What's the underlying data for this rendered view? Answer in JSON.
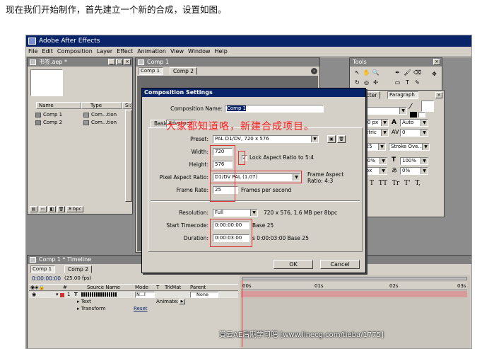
{
  "caption": "现在我们开始制作，首先建立一个新的合成，设置如图。",
  "app": {
    "title": "Adobe After Effects",
    "menu": [
      "File",
      "Edit",
      "Composition",
      "Layer",
      "Effect",
      "Animation",
      "View",
      "Window",
      "Help"
    ]
  },
  "project": {
    "title": "书签.aep *",
    "columns": {
      "name": "Name",
      "type": "Type",
      "size": "Si:"
    },
    "items": [
      {
        "name": "Comp 1",
        "type": "Com...tion"
      },
      {
        "name": "Comp 2",
        "type": "Com...tion"
      }
    ],
    "footer_bpc": "8 bpc"
  },
  "comp_window": {
    "title": "Comp 1",
    "tabs": [
      "Comp 1",
      "Comp 2"
    ]
  },
  "tools": {
    "title": "Tools"
  },
  "character": {
    "tabs": [
      "racter",
      "Paragraph"
    ],
    "font": "ar",
    "size": "100 px",
    "leading": "Auto",
    "kerning": "Metric",
    "tracking": "0",
    "stroke_width": "0.25",
    "stroke_mode": "Stroke Ove...",
    "vscale": "100%",
    "hscale": "100%",
    "baseline": "0 px",
    "tsume": "0%",
    "styles": [
      "T",
      "T",
      "TT",
      "Tr",
      "T'",
      "T,"
    ]
  },
  "dialog": {
    "title": "Composition Settings",
    "comp_name_label": "Composition Name:",
    "comp_name": "Comp 1",
    "tabs": [
      "Basic",
      "Advanced"
    ],
    "preset_label": "Preset:",
    "preset": "PAL D1/DV, 720 x 576",
    "width_label": "Width:",
    "width": "720",
    "height_label": "Height:",
    "height": "576",
    "lock_label": "Lock Aspect Ratio to 5:4",
    "par_label": "Pixel Aspect Ratio:",
    "par": "D1/DV PAL (1.07)",
    "frame_aspect": "Frame Aspect\nRatio: 4:3",
    "framerate_label": "Frame Rate:",
    "framerate": "25",
    "framerate_unit": "Frames per second",
    "resolution_label": "Resolution:",
    "resolution": "Full",
    "resolution_info": "720 x 576, 1.6 MB per 8bpc",
    "start_tc_label": "Start Timecode:",
    "start_tc": "0:00:00:00",
    "start_tc_base": "Base 25",
    "duration_label": "Duration:",
    "duration": "0:00:03:00",
    "duration_info": "s 0:00:03:00  Base 25",
    "ok": "OK",
    "cancel": "Cancel"
  },
  "annotation": "大家都知道咯，新建合成项目。",
  "timeline": {
    "title": "Comp 1 * Timeline",
    "tabs": [
      "Comp 1",
      "Comp 2"
    ],
    "timecode": "0:00:00:00",
    "fps": "(25.00 fps)",
    "columns": [
      "#",
      "Source Name",
      "Mode",
      "T",
      "TrkMat",
      "Parent"
    ],
    "layer": {
      "num": "1",
      "name": "T",
      "mode": "N...l",
      "parent": "None"
    },
    "sub": [
      {
        "name": "Text",
        "extra": "Animate:"
      },
      {
        "name": "Transform",
        "extra": "Reset"
      }
    ],
    "ruler": [
      "00s",
      "01s",
      "02s",
      "03s"
    ]
  },
  "watermark": "賞云AE后期学习吧 [www.linecg.com/tieba/1775]"
}
